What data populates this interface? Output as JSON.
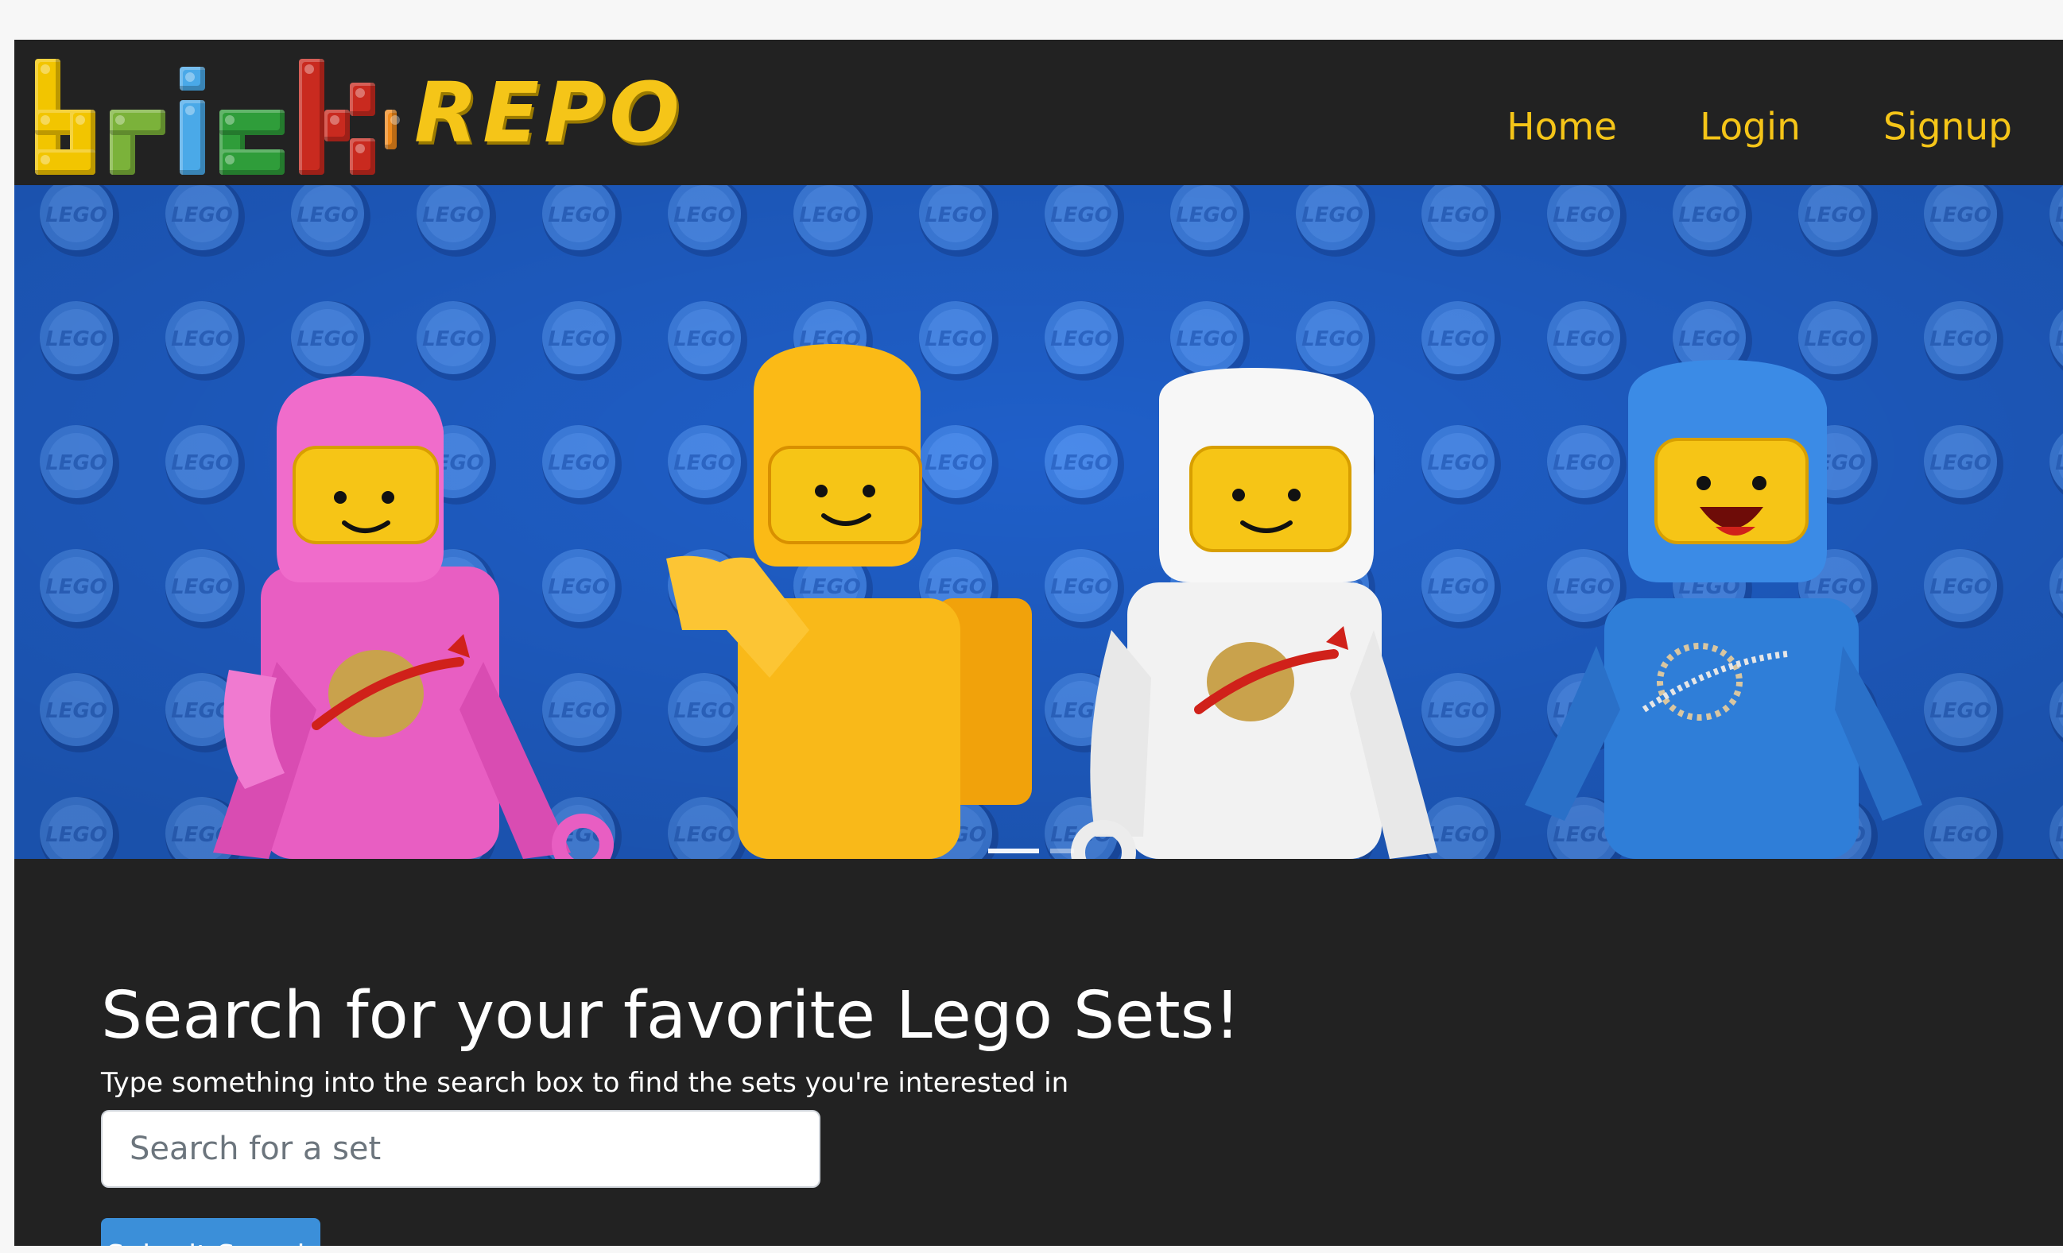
{
  "brand": {
    "logo_text": "bricky",
    "logo_suffix": "REPO",
    "colors": {
      "accent": "#f5c518",
      "nav_bg": "#222222"
    }
  },
  "nav": {
    "items": [
      {
        "label": "Home"
      },
      {
        "label": "Login"
      },
      {
        "label": "Signup"
      }
    ]
  },
  "carousel": {
    "image_alt": "",
    "active_slide": 1,
    "slides_count": 2
  },
  "search": {
    "title": "Search for your favorite Lego Sets!",
    "description": "Type something into the search box to find the sets you're interested in",
    "placeholder": "Search for a set",
    "value": "",
    "submit_label": "Submit Search",
    "submit_color": "#3b8fd9"
  }
}
